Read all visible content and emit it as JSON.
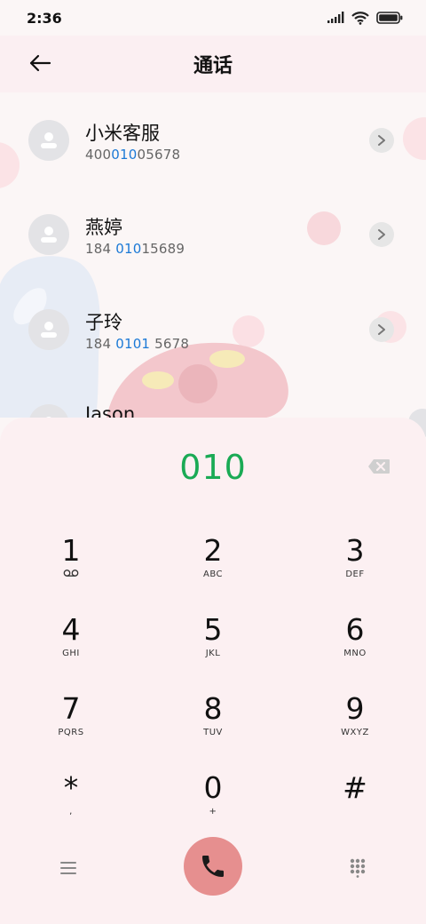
{
  "status_bar": {
    "time": "2:36",
    "icons": [
      "signal-icon",
      "wifi-icon",
      "battery-icon"
    ]
  },
  "header": {
    "title": "通话",
    "back_icon": "arrow-left-icon"
  },
  "contacts": [
    {
      "name": "小米客服",
      "number_parts": [
        "400",
        "010",
        "05678"
      ]
    },
    {
      "name": "燕婷",
      "number_parts": [
        "184 ",
        "010",
        "15689"
      ]
    },
    {
      "name": "子玲",
      "number_parts": [
        "184 ",
        "0101",
        " 5678"
      ]
    },
    {
      "name": "Jason",
      "number_parts": [
        "",
        "",
        ""
      ]
    }
  ],
  "dialer": {
    "input": "010",
    "keys": [
      {
        "digit": "1",
        "letters": ""
      },
      {
        "digit": "2",
        "letters": "ABC"
      },
      {
        "digit": "3",
        "letters": "DEF"
      },
      {
        "digit": "4",
        "letters": "GHI"
      },
      {
        "digit": "5",
        "letters": "JKL"
      },
      {
        "digit": "6",
        "letters": "MNO"
      },
      {
        "digit": "7",
        "letters": "PQRS"
      },
      {
        "digit": "8",
        "letters": "TUV"
      },
      {
        "digit": "9",
        "letters": "WXYZ"
      },
      {
        "digit": "*",
        "letters": ","
      },
      {
        "digit": "0",
        "letters": "+"
      },
      {
        "digit": "#",
        "letters": ""
      }
    ]
  },
  "colors": {
    "match_highlight": "#1b79d6",
    "dial_input": "#1aaa55",
    "call_button": "#e68f8f",
    "sheet_bg": "#fcf0f2"
  }
}
